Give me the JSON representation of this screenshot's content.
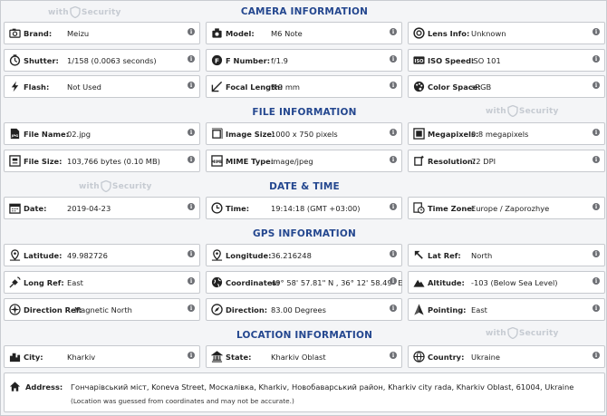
{
  "watermark": {
    "prefix": "with",
    "brand": "Security"
  },
  "sections": {
    "camera": "CAMERA INFORMATION",
    "file": "FILE INFORMATION",
    "datetime": "DATE & TIME",
    "gps": "GPS INFORMATION",
    "location": "LOCATION INFORMATION"
  },
  "camera": {
    "brand": {
      "label": "Brand:",
      "value": "Meizu"
    },
    "model": {
      "label": "Model:",
      "value": "M6 Note"
    },
    "lens": {
      "label": "Lens Info:",
      "value": "Unknown"
    },
    "shutter": {
      "label": "Shutter:",
      "value": "1/158 (0.0063 seconds)"
    },
    "fnumber": {
      "label": "F Number:",
      "value": "f/1.9"
    },
    "iso": {
      "label": "ISO Speed:",
      "value": "ISO 101"
    },
    "flash": {
      "label": "Flash:",
      "value": "Not Used"
    },
    "focal": {
      "label": "Focal Length:",
      "value": "3.9 mm"
    },
    "colorspace": {
      "label": "Color Space:",
      "value": "sRGB"
    }
  },
  "file": {
    "name": {
      "label": "File Name:",
      "value": "02.jpg"
    },
    "imagesize": {
      "label": "Image Size:",
      "value": "1000 x 750 pixels"
    },
    "megapixels": {
      "label": "Megapixels:",
      "value": "0.8 megapixels"
    },
    "filesize": {
      "label": "File Size:",
      "value": "103,766 bytes (0.10 MB)"
    },
    "mime": {
      "label": "MIME Type:",
      "value": "image/jpeg"
    },
    "resolution": {
      "label": "Resolution:",
      "value": "72 DPI"
    }
  },
  "datetime": {
    "date": {
      "label": "Date:",
      "value": "2019-04-23"
    },
    "time": {
      "label": "Time:",
      "value": "19:14:18 (GMT +03:00)"
    },
    "timezone": {
      "label": "Time Zone:",
      "value": "Europe / Zaporozhye"
    }
  },
  "gps": {
    "latitude": {
      "label": "Latitude:",
      "value": "49.982726"
    },
    "longitude": {
      "label": "Longitude:",
      "value": "36.216248"
    },
    "latref": {
      "label": "Lat Ref:",
      "value": "North"
    },
    "longref": {
      "label": "Long Ref:",
      "value": "East"
    },
    "coordinates": {
      "label": "Coordinates:",
      "value": "49° 58' 57.81\" N , 36° 12' 58.49\" E"
    },
    "altitude": {
      "label": "Altitude:",
      "value": "-103 (Below Sea Level)"
    },
    "directionref": {
      "label": "Direction Ref:",
      "value": "Magnetic North"
    },
    "direction": {
      "label": "Direction:",
      "value": "83.00 Degrees"
    },
    "pointing": {
      "label": "Pointing:",
      "value": "East"
    }
  },
  "location": {
    "city": {
      "label": "City:",
      "value": "Kharkiv"
    },
    "state": {
      "label": "State:",
      "value": "Kharkiv Oblast"
    },
    "country": {
      "label": "Country:",
      "value": "Ukraine"
    },
    "address": {
      "label": "Address:",
      "value": "Гончарівський міст, Koneva Street, Москалівка, Kharkiv, Новобаварський район, Kharkiv city rada, Kharkiv Oblast, 61004, Ukraine",
      "note": "(Location was guessed from coordinates and may not be accurate.)"
    }
  },
  "info_glyph": "i",
  "colors": {
    "section_title": "#24478f",
    "card_border": "#c6c9ce",
    "info_badge": "#6e7075"
  }
}
